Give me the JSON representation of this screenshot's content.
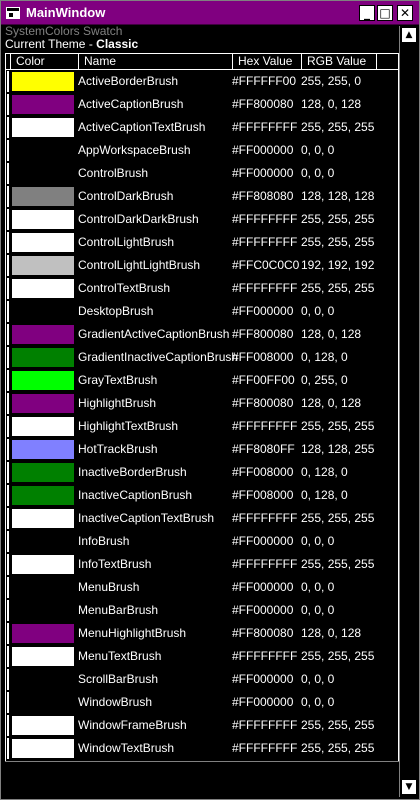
{
  "window": {
    "title": "MainWindow",
    "minimize_icon": "minimize-icon",
    "maximize_icon": "maximize-icon",
    "close_icon": "close-icon",
    "minimize_glyph": "_",
    "maximize_glyph": "□",
    "close_glyph": "✕"
  },
  "header": {
    "subtitle": "SystemColors Swatch",
    "theme_label": "Current Theme - ",
    "theme_value": "Classic"
  },
  "table": {
    "columns": [
      "Color",
      "Name",
      "Hex Value",
      "RGB Value"
    ],
    "rows": [
      {
        "name": "ActiveBorderBrush",
        "hex": "#FFFFFF00",
        "rgb": "255, 255, 0",
        "swatch": "#FFFF00"
      },
      {
        "name": "ActiveCaptionBrush",
        "hex": "#FF800080",
        "rgb": "128, 0, 128",
        "swatch": "#800080"
      },
      {
        "name": "ActiveCaptionTextBrush",
        "hex": "#FFFFFFFF",
        "rgb": "255, 255, 255",
        "swatch": "#FFFFFF"
      },
      {
        "name": "AppWorkspaceBrush",
        "hex": "#FF000000",
        "rgb": "0, 0, 0",
        "swatch": "#000000"
      },
      {
        "name": "ControlBrush",
        "hex": "#FF000000",
        "rgb": "0, 0, 0",
        "swatch": "#000000"
      },
      {
        "name": "ControlDarkBrush",
        "hex": "#FF808080",
        "rgb": "128, 128, 128",
        "swatch": "#808080"
      },
      {
        "name": "ControlDarkDarkBrush",
        "hex": "#FFFFFFFF",
        "rgb": "255, 255, 255",
        "swatch": "#FFFFFF"
      },
      {
        "name": "ControlLightBrush",
        "hex": "#FFFFFFFF",
        "rgb": "255, 255, 255",
        "swatch": "#FFFFFF"
      },
      {
        "name": "ControlLightLightBrush",
        "hex": "#FFC0C0C0",
        "rgb": "192, 192, 192",
        "swatch": "#C0C0C0"
      },
      {
        "name": "ControlTextBrush",
        "hex": "#FFFFFFFF",
        "rgb": "255, 255, 255",
        "swatch": "#FFFFFF"
      },
      {
        "name": "DesktopBrush",
        "hex": "#FF000000",
        "rgb": "0, 0, 0",
        "swatch": "#000000"
      },
      {
        "name": "GradientActiveCaptionBrush",
        "hex": "#FF800080",
        "rgb": "128, 0, 128",
        "swatch": "#800080"
      },
      {
        "name": "GradientInactiveCaptionBrush",
        "hex": "#FF008000",
        "rgb": "0, 128, 0",
        "swatch": "#008000"
      },
      {
        "name": "GrayTextBrush",
        "hex": "#FF00FF00",
        "rgb": "0, 255, 0",
        "swatch": "#00FF00"
      },
      {
        "name": "HighlightBrush",
        "hex": "#FF800080",
        "rgb": "128, 0, 128",
        "swatch": "#800080"
      },
      {
        "name": "HighlightTextBrush",
        "hex": "#FFFFFFFF",
        "rgb": "255, 255, 255",
        "swatch": "#FFFFFF"
      },
      {
        "name": "HotTrackBrush",
        "hex": "#FF8080FF",
        "rgb": "128, 128, 255",
        "swatch": "#8080FF"
      },
      {
        "name": "InactiveBorderBrush",
        "hex": "#FF008000",
        "rgb": "0, 128, 0",
        "swatch": "#008000"
      },
      {
        "name": "InactiveCaptionBrush",
        "hex": "#FF008000",
        "rgb": "0, 128, 0",
        "swatch": "#008000"
      },
      {
        "name": "InactiveCaptionTextBrush",
        "hex": "#FFFFFFFF",
        "rgb": "255, 255, 255",
        "swatch": "#FFFFFF"
      },
      {
        "name": "InfoBrush",
        "hex": "#FF000000",
        "rgb": "0, 0, 0",
        "swatch": "#000000"
      },
      {
        "name": "InfoTextBrush",
        "hex": "#FFFFFFFF",
        "rgb": "255, 255, 255",
        "swatch": "#FFFFFF"
      },
      {
        "name": "MenuBrush",
        "hex": "#FF000000",
        "rgb": "0, 0, 0",
        "swatch": "#000000"
      },
      {
        "name": "MenuBarBrush",
        "hex": "#FF000000",
        "rgb": "0, 0, 0",
        "swatch": "#000000"
      },
      {
        "name": "MenuHighlightBrush",
        "hex": "#FF800080",
        "rgb": "128, 0, 128",
        "swatch": "#800080"
      },
      {
        "name": "MenuTextBrush",
        "hex": "#FFFFFFFF",
        "rgb": "255, 255, 255",
        "swatch": "#FFFFFF"
      },
      {
        "name": "ScrollBarBrush",
        "hex": "#FF000000",
        "rgb": "0, 0, 0",
        "swatch": "#000000"
      },
      {
        "name": "WindowBrush",
        "hex": "#FF000000",
        "rgb": "0, 0, 0",
        "swatch": "#000000"
      },
      {
        "name": "WindowFrameBrush",
        "hex": "#FFFFFFFF",
        "rgb": "255, 255, 255",
        "swatch": "#FFFFFF"
      },
      {
        "name": "WindowTextBrush",
        "hex": "#FFFFFFFF",
        "rgb": "255, 255, 255",
        "swatch": "#FFFFFF"
      }
    ]
  },
  "scrollbar": {
    "up_icon": "scroll-up-arrow-icon",
    "down_icon": "scroll-down-arrow-icon",
    "up_glyph": "▲",
    "down_glyph": "▼"
  }
}
